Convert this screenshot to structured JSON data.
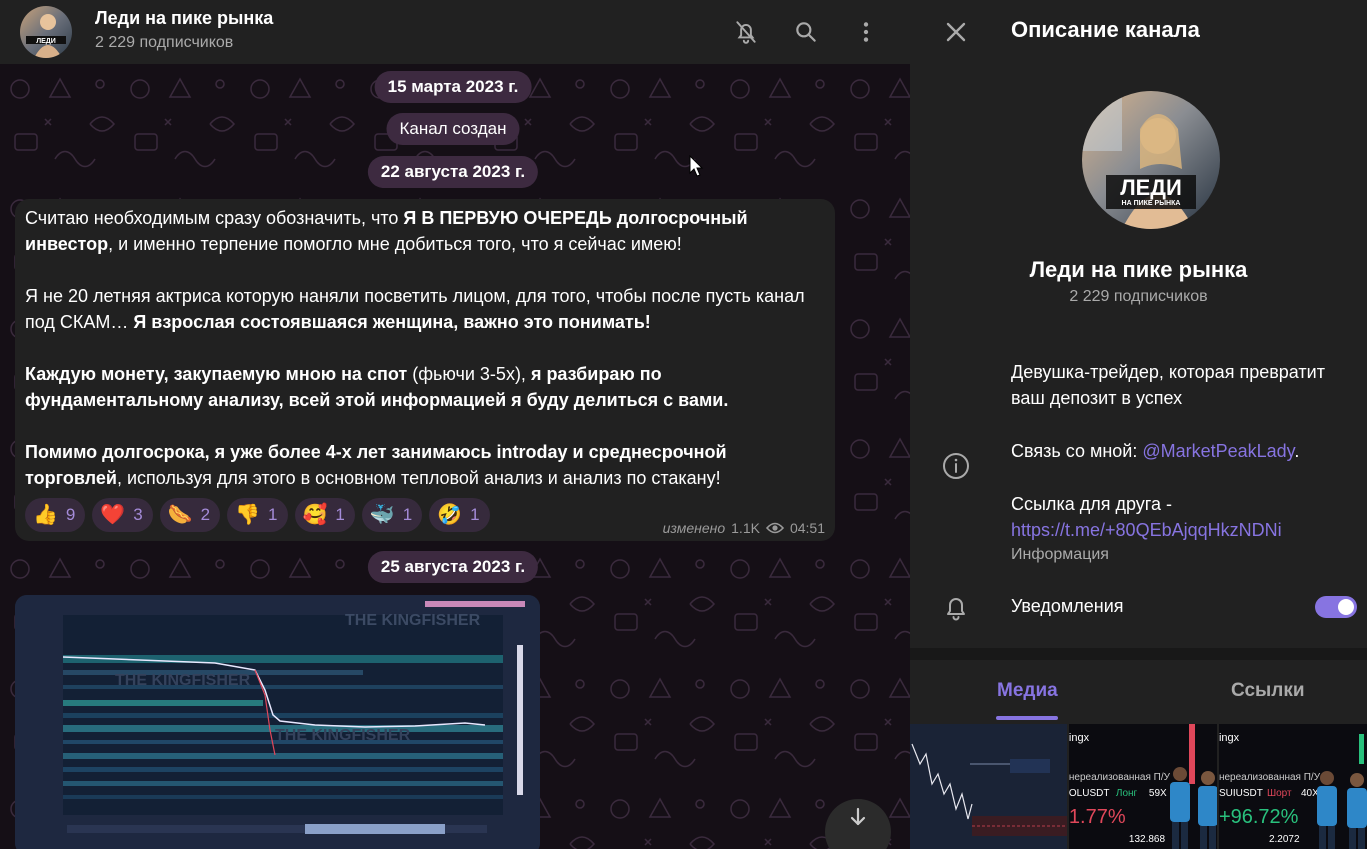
{
  "header": {
    "title": "Леди на пике рынка",
    "subtitle": "2 229 подписчиков",
    "avatar_text": "ЛЕДИ"
  },
  "chat": {
    "date_1": "15 марта 2023 г.",
    "service_created": "Канал создан",
    "date_2": "22 августа 2023 г.",
    "date_3": "25 августа 2023 г.",
    "message": {
      "p1_a": "Считаю необходимым сразу обозначить, что ",
      "p1_b": "Я В ПЕРВУЮ ОЧЕРЕДЬ долгосрочный инвестор",
      "p1_c": ", и именно терпение помогло мне добиться того, что я сейчас имею!",
      "p2_a": "Я не 20 летняя актриса которую наняли посветить лицом, для того, чтобы после пусть канал под СКАМ… ",
      "p2_b": "Я взрослая состоявшаяся женщина, важно это понимать!",
      "p3_a": "Каждую монету, закупаемую мною на спот",
      "p3_b": " (фьючи 3-5х), ",
      "p3_c": "я разбираю по фундаментальному анализу, всей этой информацией я буду делиться с вами.",
      "p4_a": "Помимо долгосрока, я уже более 4-х лет занимаюсь introday и среднесрочной торговлей",
      "p4_b": ", используя для этого в основном тепловой анализ и анализ по стакану!",
      "edited": "изменено",
      "views": "1.1K",
      "time": "04:51",
      "reactions": [
        {
          "emoji": "👍",
          "count": "9"
        },
        {
          "emoji": "❤️",
          "count": "3"
        },
        {
          "emoji": "🌭",
          "count": "2"
        },
        {
          "emoji": "👎",
          "count": "1"
        },
        {
          "emoji": "🥰",
          "count": "1"
        },
        {
          "emoji": "🐳",
          "count": "1"
        },
        {
          "emoji": "🤣",
          "count": "1"
        }
      ]
    },
    "photo_watermark": "THE KINGFISHER"
  },
  "panel": {
    "title": "Описание канала",
    "name": "Леди на пике рынка",
    "subscribers": "2 229 подписчиков",
    "avatar_title": "ЛЕДИ",
    "avatar_sub": "НА ПИКЕ РЫНКА",
    "desc_line1": "Девушка-трейдер, которая превратит ваш депозит в успех",
    "contact_prefix": "Связь со мной: ",
    "contact_link": "@MarketPeakLady",
    "contact_suffix": ".",
    "friend_label": "Ссылка для друга -",
    "friend_link": "https://t.me/+80QEbAjqqHkzNDNi",
    "info_label": "Информация",
    "notifications_label": "Уведомления",
    "notifications_on": true,
    "tab_media": "Медиа",
    "tab_links": "Ссылки"
  },
  "media": {
    "item2": {
      "brand": "ingx",
      "caption": "нереализованная П/У",
      "pair": "OLUSDT",
      "side": "Лонг",
      "lev": "59X",
      "pnl": "1.77%",
      "price": "132.868"
    },
    "item3": {
      "brand": "ingx",
      "caption": "нереализованная П/У",
      "pair": "SUIUSDT",
      "side": "Шорт",
      "lev": "40X",
      "pnl": "+96.72%",
      "price": "2.2072"
    }
  },
  "colors": {
    "accent": "#8774e1",
    "panel_bg": "#212121",
    "pill_bg": "#3d2a40",
    "reaction_bg": "#362a3c",
    "pnl_long": "#e0475a",
    "pnl_short": "#29c17d"
  }
}
